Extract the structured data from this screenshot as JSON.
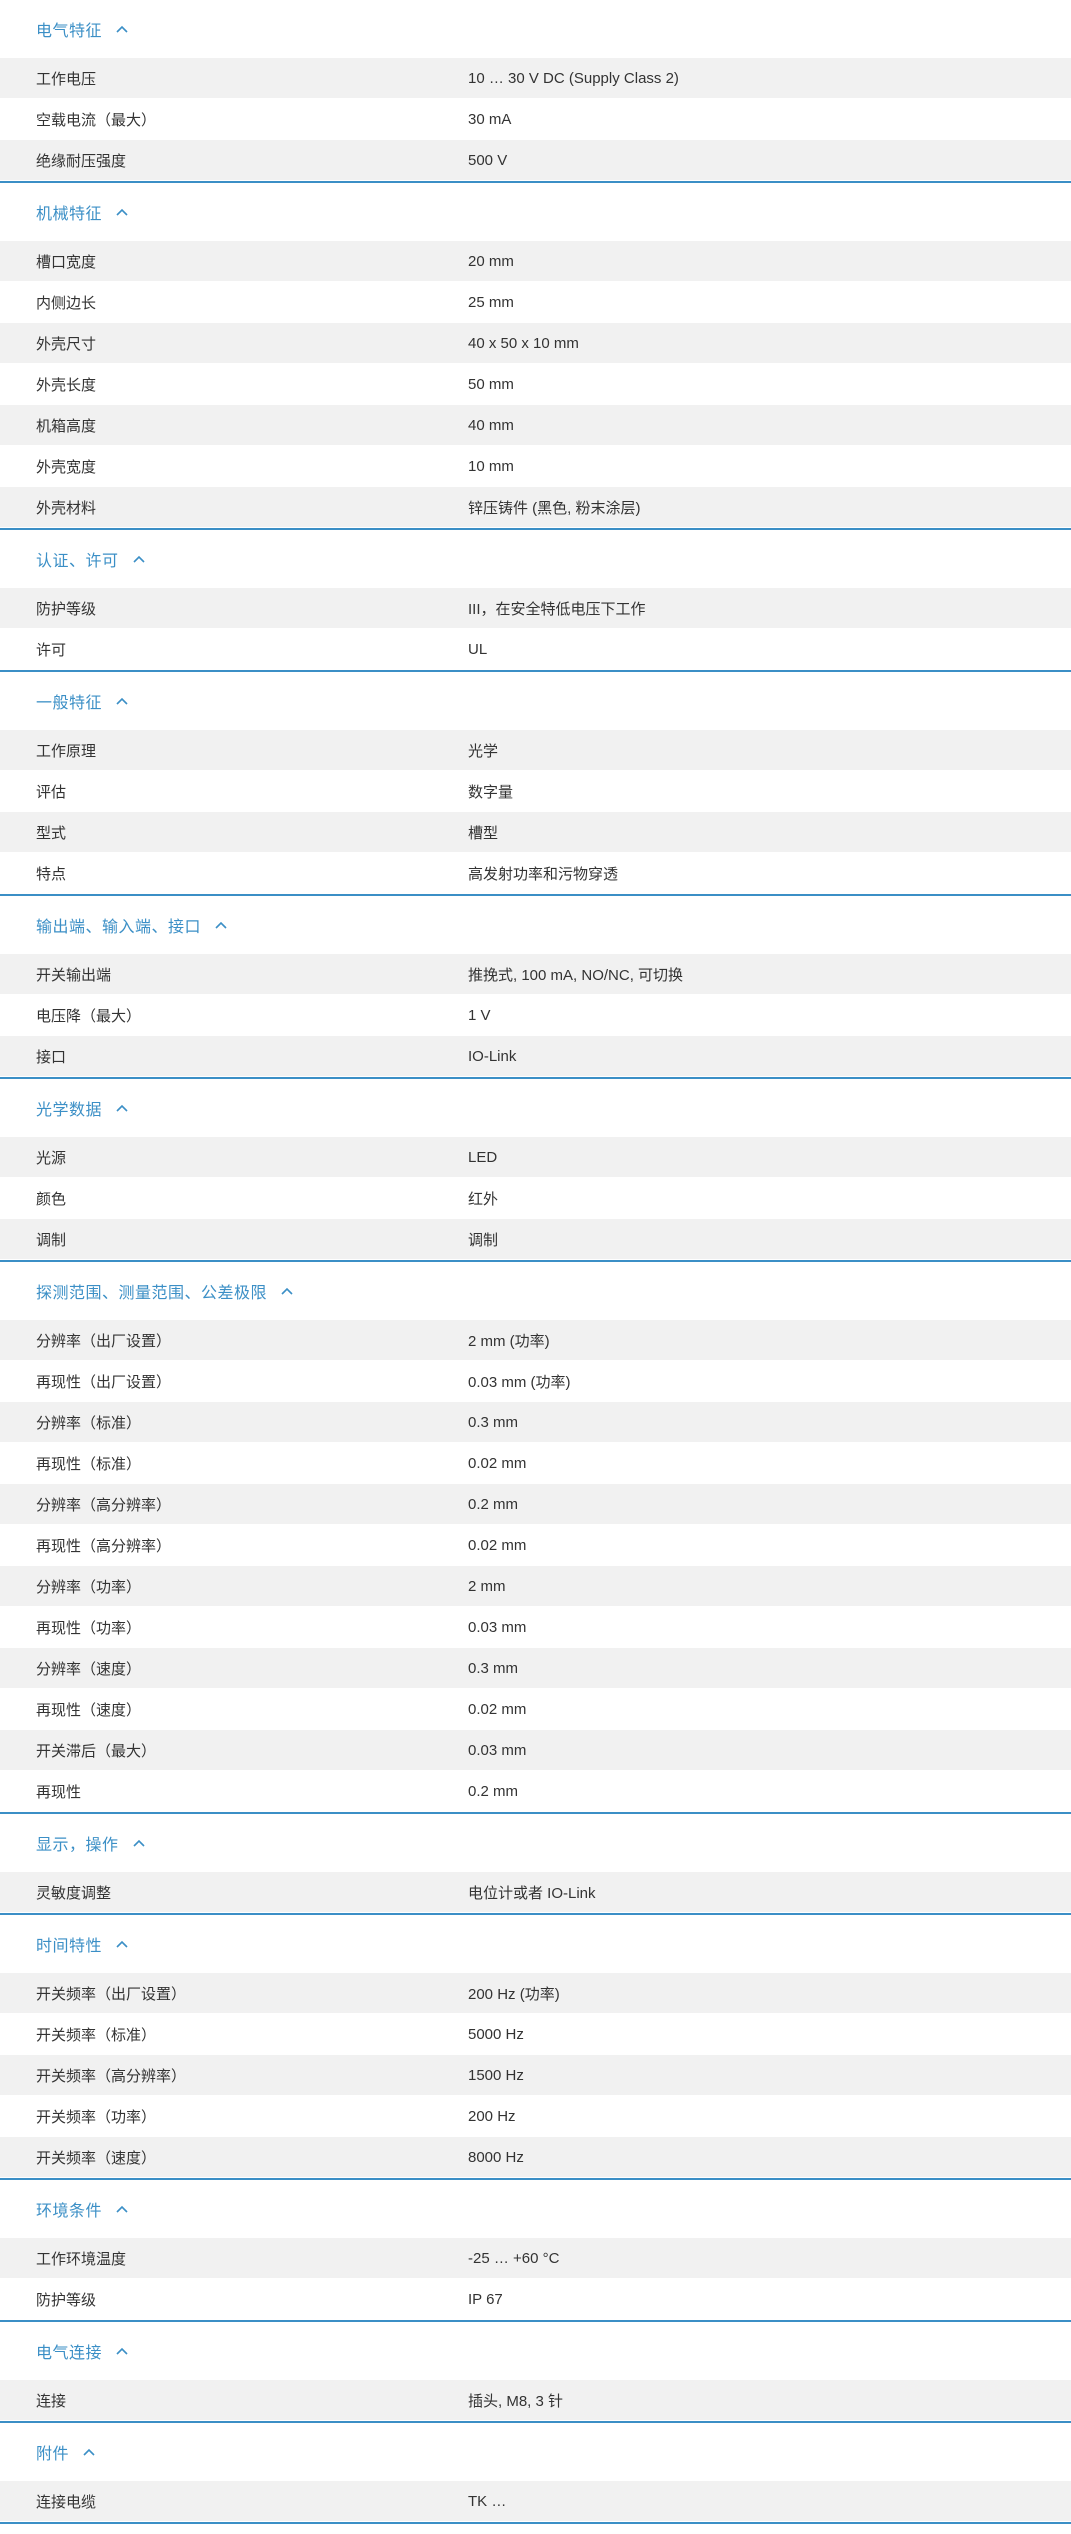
{
  "accent_color": "#3b8fc6",
  "sections": [
    {
      "title": "电气特征",
      "rows": [
        [
          "工作电压",
          "10 … 30 V DC (Supply Class 2)"
        ],
        [
          "空载电流（最大）",
          "30 mA"
        ],
        [
          "绝缘耐压强度",
          "500 V"
        ]
      ]
    },
    {
      "title": "机械特征",
      "rows": [
        [
          "槽口宽度",
          "20 mm"
        ],
        [
          "内侧边长",
          "25 mm"
        ],
        [
          "外壳尺寸",
          "40 x 50 x 10 mm"
        ],
        [
          "外壳长度",
          "50 mm"
        ],
        [
          "机箱高度",
          "40 mm"
        ],
        [
          "外壳宽度",
          "10 mm"
        ],
        [
          "外壳材料",
          "锌压铸件 (黑色, 粉末涂层)"
        ]
      ]
    },
    {
      "title": "认证、许可",
      "rows": [
        [
          "防护等级",
          "III，在安全特低电压下工作"
        ],
        [
          "许可",
          "UL"
        ]
      ]
    },
    {
      "title": "一般特征",
      "rows": [
        [
          "工作原理",
          "光学"
        ],
        [
          "评估",
          "数字量"
        ],
        [
          "型式",
          "槽型"
        ],
        [
          "特点",
          "高发射功率和污物穿透"
        ]
      ]
    },
    {
      "title": "输出端、输入端、接口",
      "rows": [
        [
          "开关输出端",
          "推挽式, 100 mA, NO/NC, 可切换"
        ],
        [
          "电压降（最大）",
          "1 V"
        ],
        [
          "接口",
          "IO-Link"
        ]
      ]
    },
    {
      "title": "光学数据",
      "rows": [
        [
          "光源",
          "LED"
        ],
        [
          "颜色",
          "红外"
        ],
        [
          "调制",
          "调制"
        ]
      ]
    },
    {
      "title": "探测范围、测量范围、公差极限",
      "rows": [
        [
          "分辨率（出厂设置）",
          "2 mm (功率)"
        ],
        [
          "再现性（出厂设置）",
          "0.03 mm (功率)"
        ],
        [
          "分辨率（标准）",
          "0.3 mm"
        ],
        [
          "再现性（标准）",
          "0.02 mm"
        ],
        [
          "分辨率（高分辨率）",
          "0.2 mm"
        ],
        [
          "再现性（高分辨率）",
          "0.02 mm"
        ],
        [
          "分辨率（功率）",
          "2 mm"
        ],
        [
          "再现性（功率）",
          "0.03 mm"
        ],
        [
          "分辨率（速度）",
          "0.3 mm"
        ],
        [
          "再现性（速度）",
          "0.02 mm"
        ],
        [
          "开关滞后（最大）",
          "0.03 mm"
        ],
        [
          "再现性",
          "0.2 mm"
        ]
      ]
    },
    {
      "title": "显示，操作",
      "rows": [
        [
          "灵敏度调整",
          "电位计或者 IO-Link"
        ]
      ]
    },
    {
      "title": "时间特性",
      "rows": [
        [
          "开关频率（出厂设置）",
          "200 Hz (功率)"
        ],
        [
          "开关频率（标准）",
          "5000 Hz"
        ],
        [
          "开关频率（高分辨率）",
          "1500 Hz"
        ],
        [
          "开关频率（功率）",
          "200 Hz"
        ],
        [
          "开关频率（速度）",
          "8000 Hz"
        ]
      ]
    },
    {
      "title": "环境条件",
      "rows": [
        [
          "工作环境温度",
          "-25 … +60 °C"
        ],
        [
          "防护等级",
          "IP 67"
        ]
      ]
    },
    {
      "title": "电气连接",
      "rows": [
        [
          "连接",
          "插头, M8, 3 针"
        ]
      ]
    },
    {
      "title": "附件",
      "rows": [
        [
          "连接电缆",
          "TK …"
        ]
      ]
    }
  ]
}
